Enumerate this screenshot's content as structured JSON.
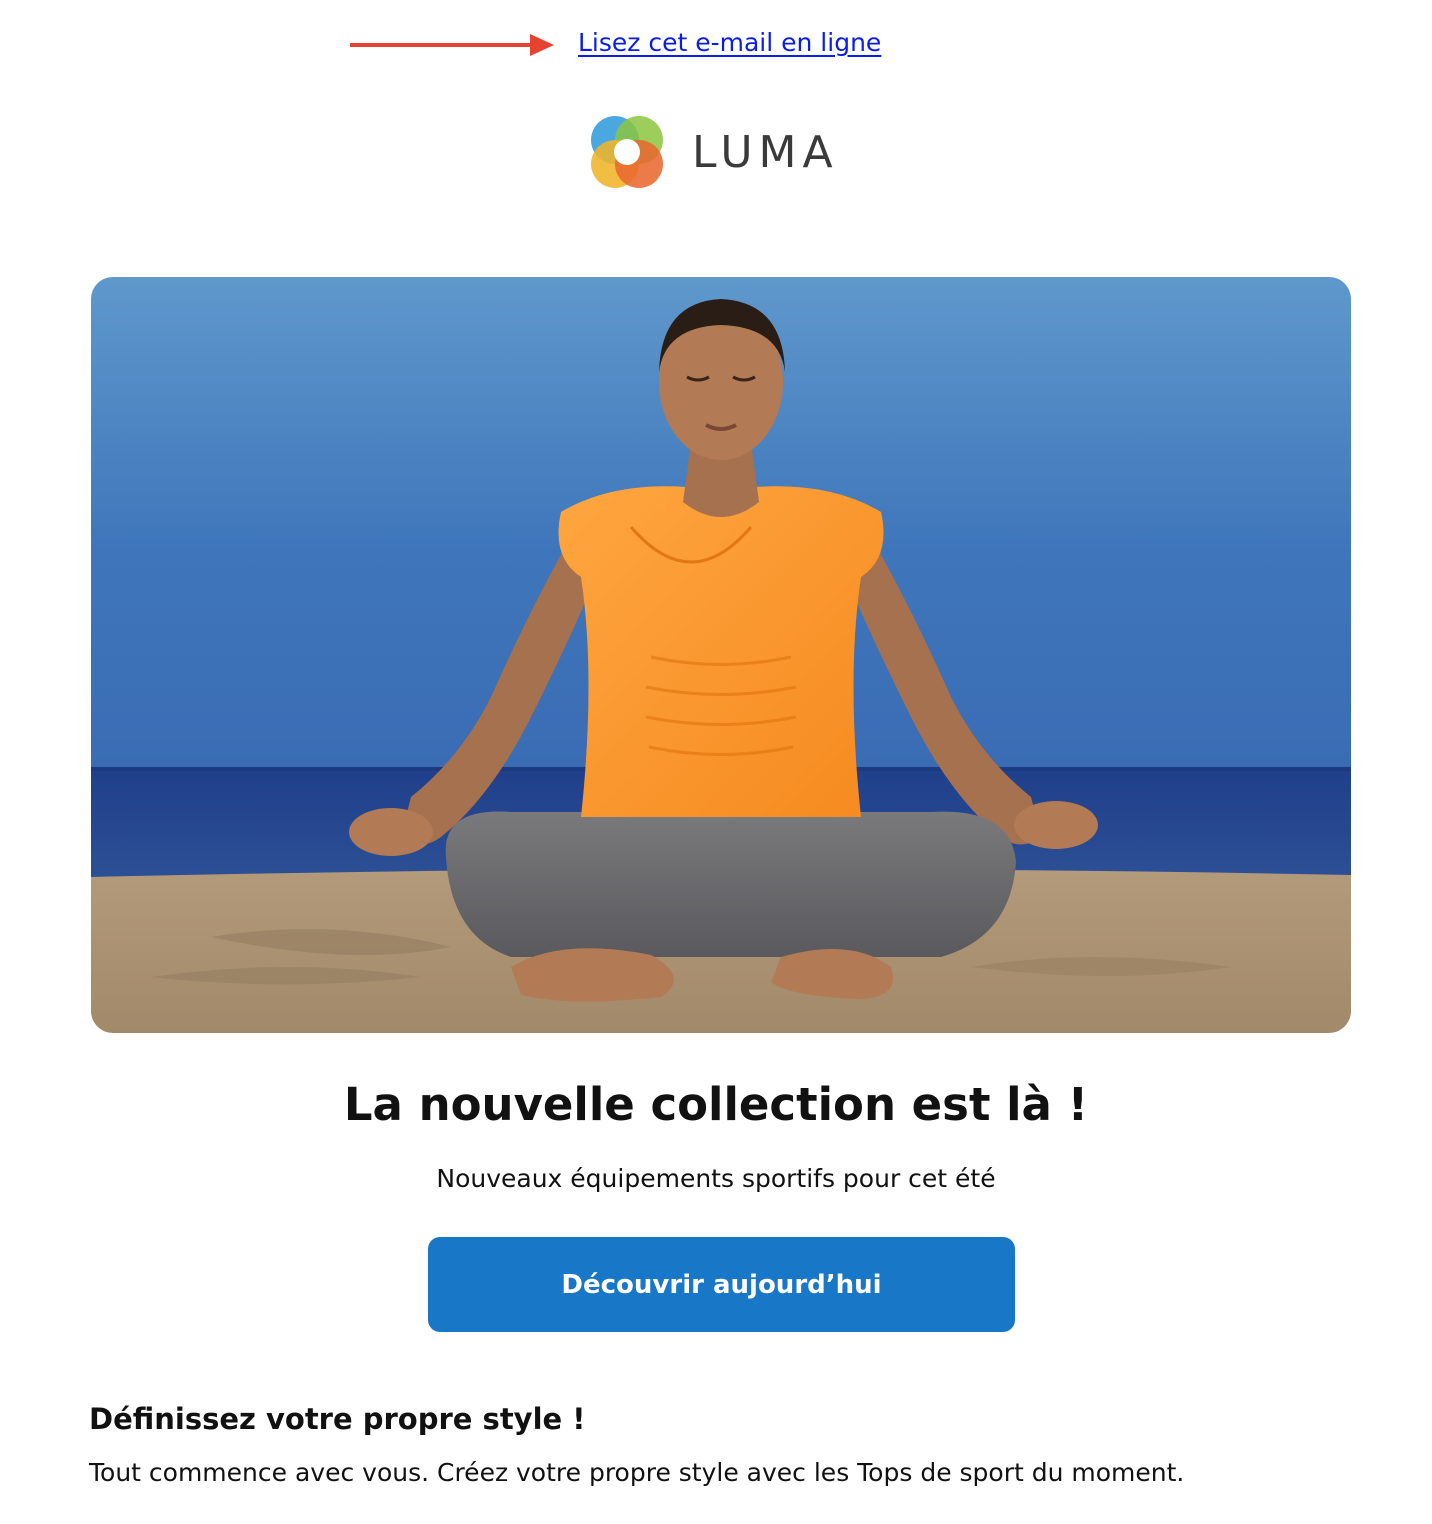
{
  "header": {
    "online_link_label": "Lisez cet e-mail en ligne"
  },
  "logo": {
    "text": "LUMA",
    "colors": [
      "#3aa1dc",
      "#8cc63f",
      "#f0b429",
      "#e8692f"
    ]
  },
  "hero": {
    "image_icon": "meditation-photo"
  },
  "main": {
    "headline": "La nouvelle collection est là !",
    "subheadline": "Nouveaux équipements sportifs pour cet été",
    "cta_label": "Découvrir aujourd’hui"
  },
  "section": {
    "title": "Définissez votre propre style !",
    "body": "Tout commence avec vous. Créez votre propre style avec les Tops de sport du moment."
  },
  "colors": {
    "link": "#0a1ee8",
    "arrow": "#e5432f",
    "button": "#1877c6"
  }
}
